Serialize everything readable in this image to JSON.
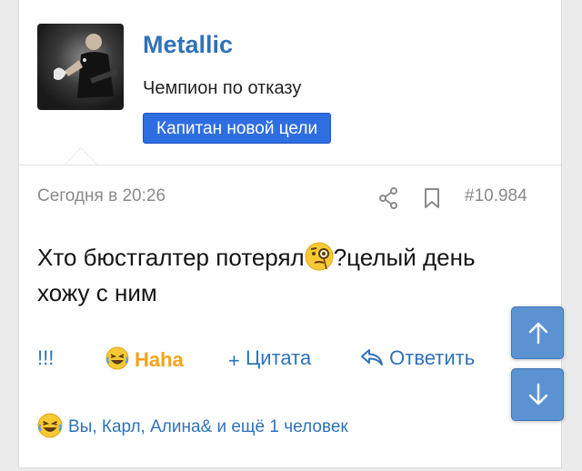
{
  "post": {
    "username": "Metallic",
    "user_title": "Чемпион по отказу",
    "banner": "Капитан новой цели",
    "date": "Сегодня в 20:26",
    "post_number": "#10.984",
    "message_part1": "Хто бюстгалтер потерял",
    "message_part2": "?целый день хожу с ним"
  },
  "actions": {
    "report": "!!!",
    "haha": "Haha",
    "quote_plus": "+",
    "quote": "Цитата",
    "reply": "Ответить"
  },
  "reactions": {
    "text": "Вы, Карл, Алина& и ещё 1 человек"
  },
  "icons": {
    "share": "share-icon",
    "bookmark": "bookmark-icon",
    "reply": "reply-arrow-icon",
    "laugh": "laughing-emoji-icon",
    "monocle": "monocle-face-emoji-icon",
    "scroll_up": "arrow-up-icon",
    "scroll_down": "arrow-down-icon"
  },
  "colors": {
    "link": "#2f72b8",
    "banner": "#2f6ee0",
    "haha": "#f6a21b",
    "meta": "#8a8a8a",
    "scroll_button": "#5b93d2"
  }
}
